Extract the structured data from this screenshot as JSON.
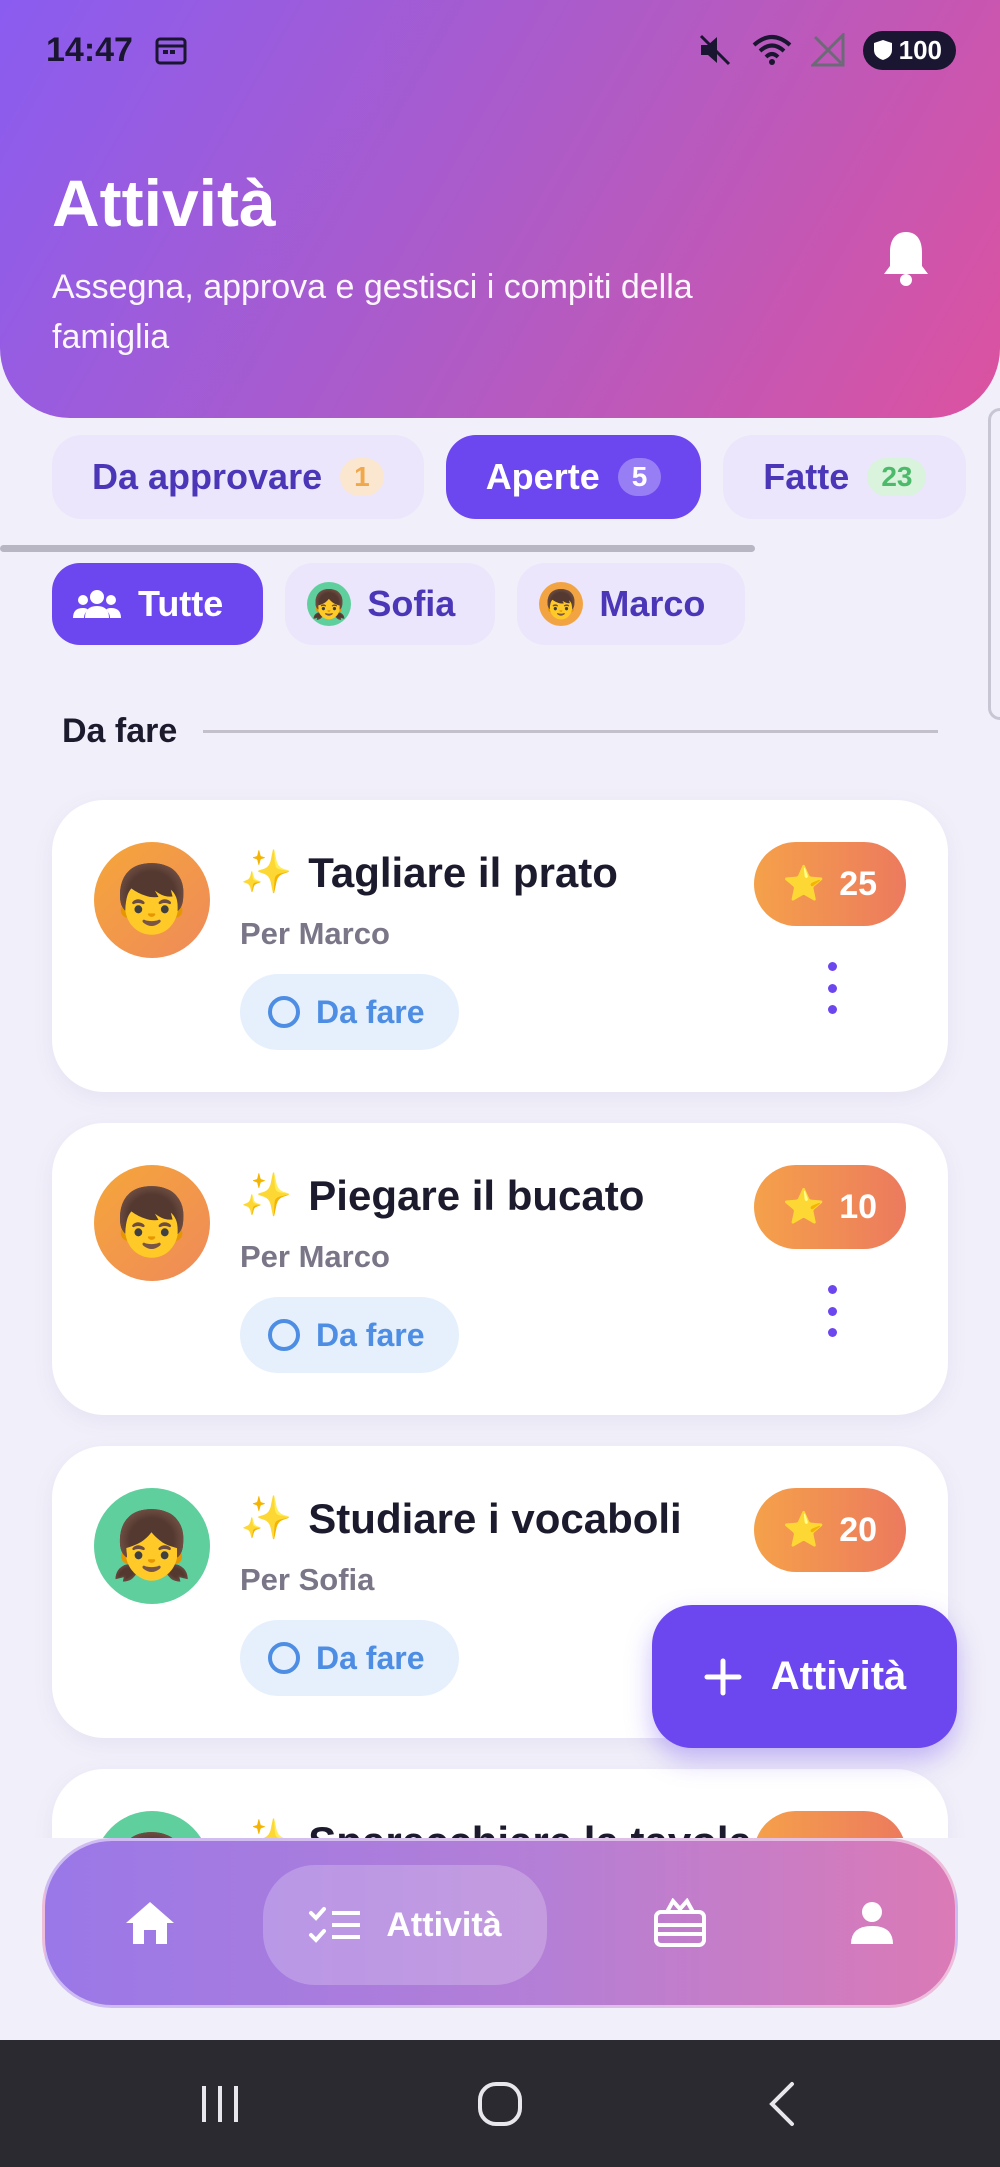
{
  "status_bar": {
    "time": "14:47",
    "battery": "100",
    "icons": [
      "calendar-icon",
      "mute-icon",
      "wifi-icon",
      "no-signal-icon",
      "battery-icon"
    ]
  },
  "header": {
    "title": "Attività",
    "subtitle": "Assegna, approva e gestisci i compiti della famiglia",
    "gradient": [
      "#8a5cf0",
      "#dc52a0"
    ]
  },
  "tabs": [
    {
      "label": "Da approvare",
      "count": "1",
      "active": false
    },
    {
      "label": "Aperte",
      "count": "5",
      "active": true
    },
    {
      "label": "Fatte",
      "count": "23",
      "active": false
    }
  ],
  "filters": [
    {
      "label": "Tutte",
      "icon": "group-icon",
      "active": true
    },
    {
      "label": "Sofia",
      "icon": "girl-emoji",
      "active": false
    },
    {
      "label": "Marco",
      "icon": "boy-emoji",
      "active": false
    }
  ],
  "section": {
    "title": "Da fare"
  },
  "tasks": [
    {
      "title": "Tagliare il prato",
      "assignee": "Per Marco",
      "status": "Da fare",
      "points": "25",
      "avatar": "boy-emoji"
    },
    {
      "title": "Piegare il bucato",
      "assignee": "Per Marco",
      "status": "Da fare",
      "points": "10",
      "avatar": "boy-emoji"
    },
    {
      "title": "Studiare i vocaboli",
      "assignee": "Per Sofia",
      "status": "Da fare",
      "points": "20",
      "avatar": "girl-emoji"
    },
    {
      "title": "Sparecchiare la tavola",
      "assignee": "",
      "status": "",
      "points": "",
      "avatar": "girl-emoji"
    }
  ],
  "fab": {
    "label": "Attività"
  },
  "bottom_nav": [
    {
      "icon": "home-icon",
      "label": "",
      "active": false
    },
    {
      "icon": "tasks-icon",
      "label": "Attività",
      "active": true
    },
    {
      "icon": "gift-icon",
      "label": "",
      "active": false
    },
    {
      "icon": "profile-icon",
      "label": "",
      "active": false
    }
  ],
  "colors": {
    "accent": "#6c47f0",
    "points": "#f5a14a",
    "status_blue": "#4d8de3"
  }
}
